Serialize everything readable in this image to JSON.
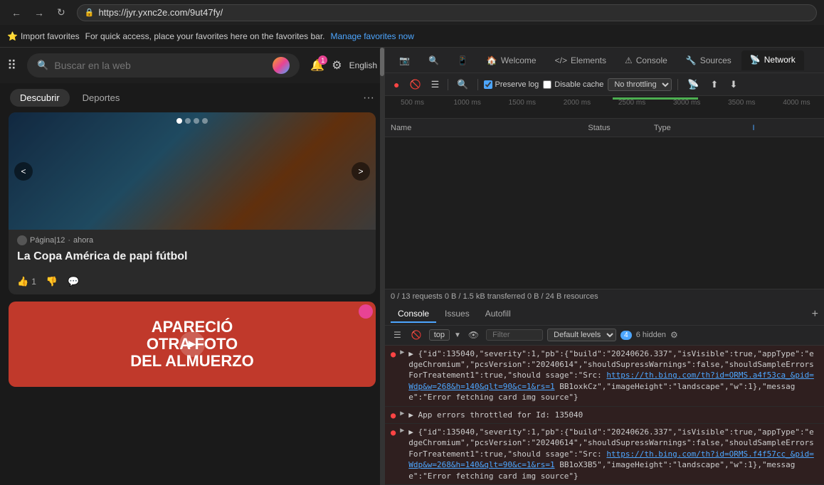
{
  "browser": {
    "back_label": "←",
    "forward_label": "→",
    "refresh_label": "↻",
    "url": "https://jyr.yxnc2e.com/9ut47fy/",
    "favorites_import": "Import favorites",
    "favorites_message": "For quick access, place your favorites here on the favorites bar.",
    "manage_favorites": "Manage favorites now"
  },
  "toolbar": {
    "search_placeholder": "Buscar en la web",
    "lang": "English",
    "notif_count": "1",
    "tab1": "Descubrir",
    "tab2": "Deportes"
  },
  "news_card": {
    "source": "Página|12",
    "time": "ahora",
    "title": "La Copa América de papi fútbol",
    "like_count": "1"
  },
  "news_card2": {
    "text1": "APARECIÓ",
    "text2": "OTRA FOTO",
    "text3": "DEL ALMUERZO"
  },
  "devtools": {
    "tab_welcome": "Welcome",
    "tab_elements": "Elements",
    "tab_console": "Console",
    "tab_sources": "Sources",
    "tab_network": "Network",
    "preserve_log": "Preserve log",
    "disable_cache": "Disable cache",
    "no_throttling": "No throttling",
    "tl_500": "500 ms",
    "tl_1000": "1000 ms",
    "tl_1500": "1500 ms",
    "tl_2000": "2000 ms",
    "tl_2500": "2500 ms",
    "tl_3000": "3000 ms",
    "tl_3500": "3500 ms",
    "tl_4000": "4000 ms",
    "col_name": "Name",
    "col_status": "Status",
    "col_type": "Type",
    "col_init": "I",
    "status_text": "0 / 13 requests  0 B / 1.5 kB transferred  0 B / 24 B resources",
    "cons_tab1": "Console",
    "cons_tab2": "Issues",
    "cons_tab3": "Autofill",
    "cons_top": "top",
    "cons_filter_placeholder": "Filter",
    "cons_default": "Default levels",
    "cons_badge": "4",
    "cons_hidden": "6 hidden",
    "entry1_text": "▶ {\"id\":135040,\"severity\":1,\"pb\":{\"build\":\"20240626.337\",\"isVisible\":true,\"appType\":\"edgeChromium\",\"pcsVersion\":\"20240614\",\"shouldSupressWarnings\":false,\"shouldSampleErrorsForTreatement1\":true,\"should",
    "entry1_cont": "ssage\":\"Src: ",
    "entry1_link": "https://th.bing.com/th?id=ORMS.a4f53ca_&pid=Wdp&w=268&h=140&qlt=90&c=1&rs=1",
    "entry1_end": " BB1oxkCz\",\"imageHeight\":\"landscape\",\"w\":1},\"message\":\"Error fetching card img source\"}",
    "entry2_text": "▶ App errors throttled for Id: 135040",
    "entry3_text": "▶ {\"id\":135040,\"severity\":1,\"pb\":{\"build\":\"20240626.337\",\"isVisible\":true,\"appType\":\"edgeChromium\",\"pcsVersion\":\"20240614\",\"shouldSupressWarnings\":false,\"shouldSampleErrorsForTreatement1\":true,\"should",
    "entry3_cont": "ssage\":\"Src: ",
    "entry3_link": "https://th.bing.com/th?id=ORMS.f4f57cc_&pid=Wdp&w=268&h=140&qlt=90&c=1&rs=1",
    "entry3_end": " BB1oX3B5\",\"imageHeight\":\"landscape\",\"w\":1},\"message\":\"Error fetching card img source\"}"
  }
}
